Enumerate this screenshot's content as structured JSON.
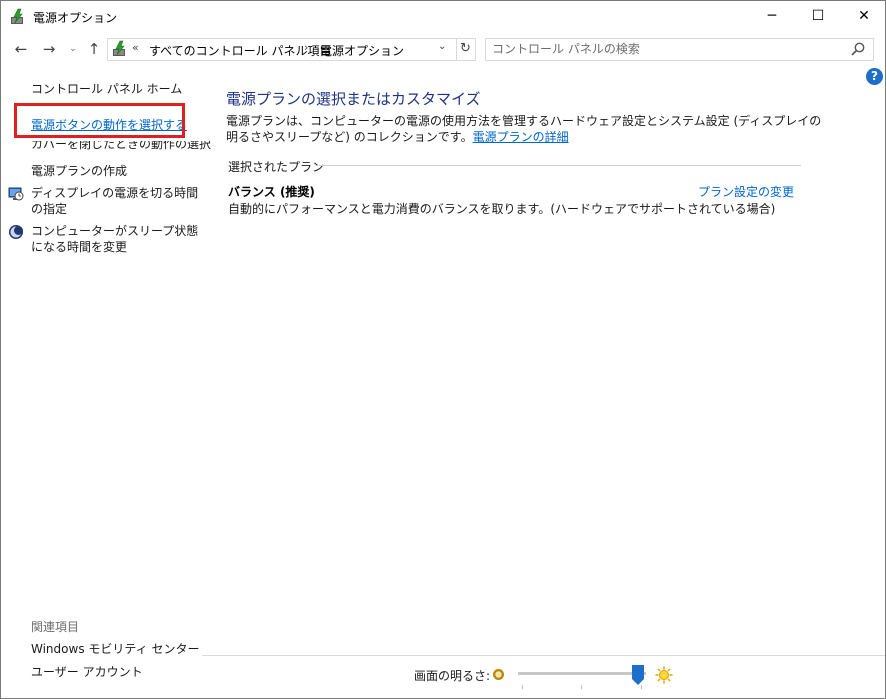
{
  "window": {
    "title": "電源オプション",
    "minimize": "─",
    "maximize": "☐",
    "close": "✕"
  },
  "nav": {
    "back": "←",
    "forward": "→",
    "recent": "⌄",
    "up": "↑"
  },
  "address": {
    "chevron": "«",
    "crumb1": "すべてのコントロール パネル項目",
    "separator": "›",
    "crumb2": "電源オプション",
    "dropdown": "⌄",
    "refresh": "↻"
  },
  "search": {
    "placeholder": "コントロール パネルの検索"
  },
  "help": "?",
  "sidebar": {
    "home": "コントロール パネル ホーム",
    "power_button": "電源ボタンの動作を選択する",
    "lid": "カバーを閉じたときの動作の選択",
    "create_plan": "電源プランの作成",
    "display_off": "ディスプレイの電源を切る時間の指定",
    "sleep": "コンピューターがスリープ状態になる時間を変更",
    "related_heading": "関連項目",
    "mobility": "Windows モビリティ センター",
    "user_accounts": "ユーザー アカウント"
  },
  "main": {
    "title": "電源プランの選択またはカスタマイズ",
    "description": "電源プランは、コンピューターの電源の使用方法を管理するハードウェア設定とシステム設定 (ディスプレイの明るさやスリープなど) のコレクションです。",
    "details_link": "電源プランの詳細",
    "selected_plan_label": "選択されたプラン",
    "plan_name": "バランス (推奨)",
    "plan_description": "自動的にパフォーマンスと電力消費のバランスを取ります。(ハードウェアでサポートされている場合)",
    "plan_change_link": "プラン設定の変更"
  },
  "brightness": {
    "label": "画面の明るさ:",
    "level": 0.94
  },
  "colors": {
    "link": "#0066cc",
    "title": "#1e3287",
    "highlight": "#e02020",
    "slider_thumb": "#1e6fcb"
  },
  "icons": {
    "app": "power-options-icon",
    "search": "search-icon",
    "display": "display-clock-icon",
    "sleep": "moon-icon",
    "brightness_dim": "dim-sun-icon",
    "brightness_full": "bright-sun-icon"
  }
}
